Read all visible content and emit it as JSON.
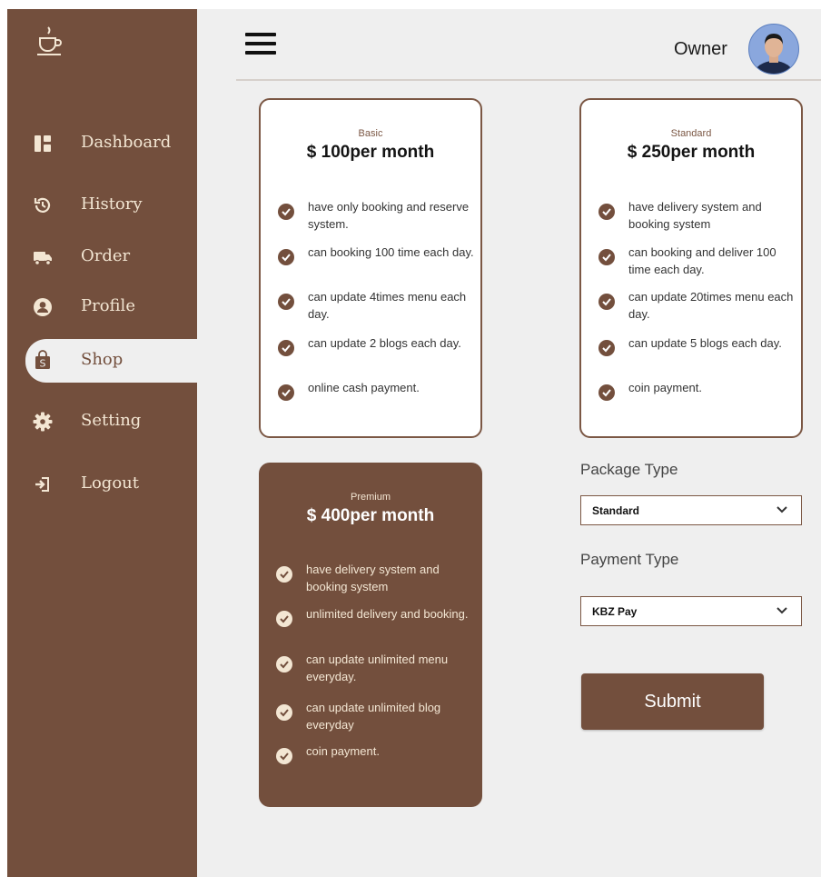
{
  "sidebar": {
    "items": [
      {
        "label": "Dashboard",
        "icon": "dashboard-icon"
      },
      {
        "label": "History",
        "icon": "history-icon"
      },
      {
        "label": "Order",
        "icon": "truck-icon"
      },
      {
        "label": "Profile",
        "icon": "user-icon"
      },
      {
        "label": "Shop",
        "icon": "shopping-bag-icon",
        "active": true
      },
      {
        "label": "Setting",
        "icon": "gear-icon"
      },
      {
        "label": "Logout",
        "icon": "logout-icon"
      }
    ]
  },
  "header": {
    "user_name": "Owner"
  },
  "plans": [
    {
      "tier": "Basic",
      "price": "$ 100per month",
      "features": [
        "have only booking and reserve system.",
        "can booking 100 time each day.",
        "can update 4times menu each day.",
        "can update 2 blogs each day.",
        "online cash payment."
      ]
    },
    {
      "tier": "Standard",
      "price": "$ 250per month",
      "features": [
        "have delivery system and booking system",
        "can booking and deliver 100 time each day.",
        "can update 20times menu each day.",
        "can update 5 blogs each day.",
        "coin payment."
      ]
    },
    {
      "tier": "Premium",
      "price": "$ 400per month",
      "features": [
        "have delivery system and booking system",
        "unlimited delivery and booking.",
        "can update unlimited menu everyday.",
        "can update unlimited blog everyday",
        "coin payment."
      ]
    }
  ],
  "form": {
    "package_label": "Package Type",
    "package_value": "Standard",
    "payment_label": "Payment Type",
    "payment_value": "KBZ Pay",
    "submit_label": "Submit"
  },
  "colors": {
    "brand_brown": "#734f3d",
    "cream": "#f3e6d3",
    "background": "#efefef"
  }
}
